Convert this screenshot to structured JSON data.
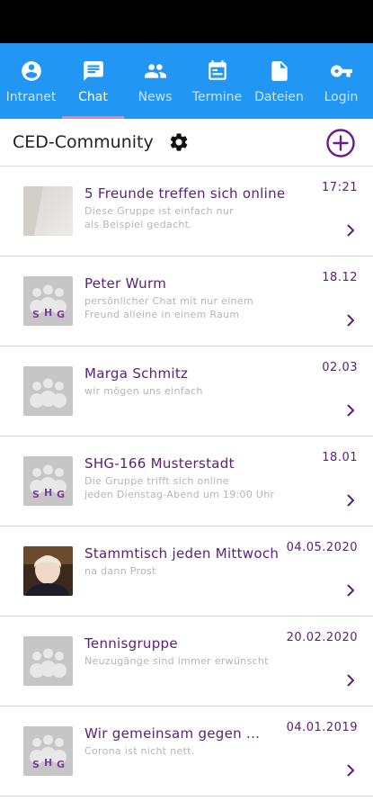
{
  "tabs": [
    {
      "label": "Intranet",
      "icon": "account-circle-icon"
    },
    {
      "label": "Chat",
      "icon": "chat-icon",
      "active": true
    },
    {
      "label": "News",
      "icon": "people-icon"
    },
    {
      "label": "Termine",
      "icon": "calendar-icon"
    },
    {
      "label": "Dateien",
      "icon": "file-icon"
    },
    {
      "label": "Login",
      "icon": "key-icon"
    }
  ],
  "header": {
    "title": "CED-Community"
  },
  "colors": {
    "accent": "#2196f3",
    "brand": "#5b2174",
    "tab_indicator": "#ea80b0"
  },
  "chats": [
    {
      "name": "5 Freunde treffen sich online",
      "sub": "Diese Gruppe ist einfach nur\nals Beispiel gedacht.",
      "time": "17:21",
      "thumb": "photo"
    },
    {
      "name": "Peter Wurm",
      "sub": "persönlicher Chat mit nur einem\nFreund alleine in einem Raum",
      "time": "18.12",
      "thumb": "shg"
    },
    {
      "name": "Marga Schmitz",
      "sub": "wir mögen uns einfach",
      "time": "02.03",
      "thumb": "group"
    },
    {
      "name": "SHG-166 Musterstadt",
      "sub": "Die Gruppe trifft sich online\njeden Dienstag-Abend um 19:00 Uhr",
      "time": "18.01",
      "thumb": "shg"
    },
    {
      "name": "Stammtisch jeden Mittwoch",
      "sub": "na dann Prost",
      "time": "04.05.2020",
      "thumb": "person"
    },
    {
      "name": "Tennisgruppe",
      "sub": "Neuzugänge sind immer erwünscht",
      "time": "20.02.2020",
      "thumb": "group"
    },
    {
      "name": "Wir gemeinsam gegen ...",
      "sub": "Corona ist nicht nett.",
      "time": "04.01.2019",
      "thumb": "shg"
    }
  ]
}
